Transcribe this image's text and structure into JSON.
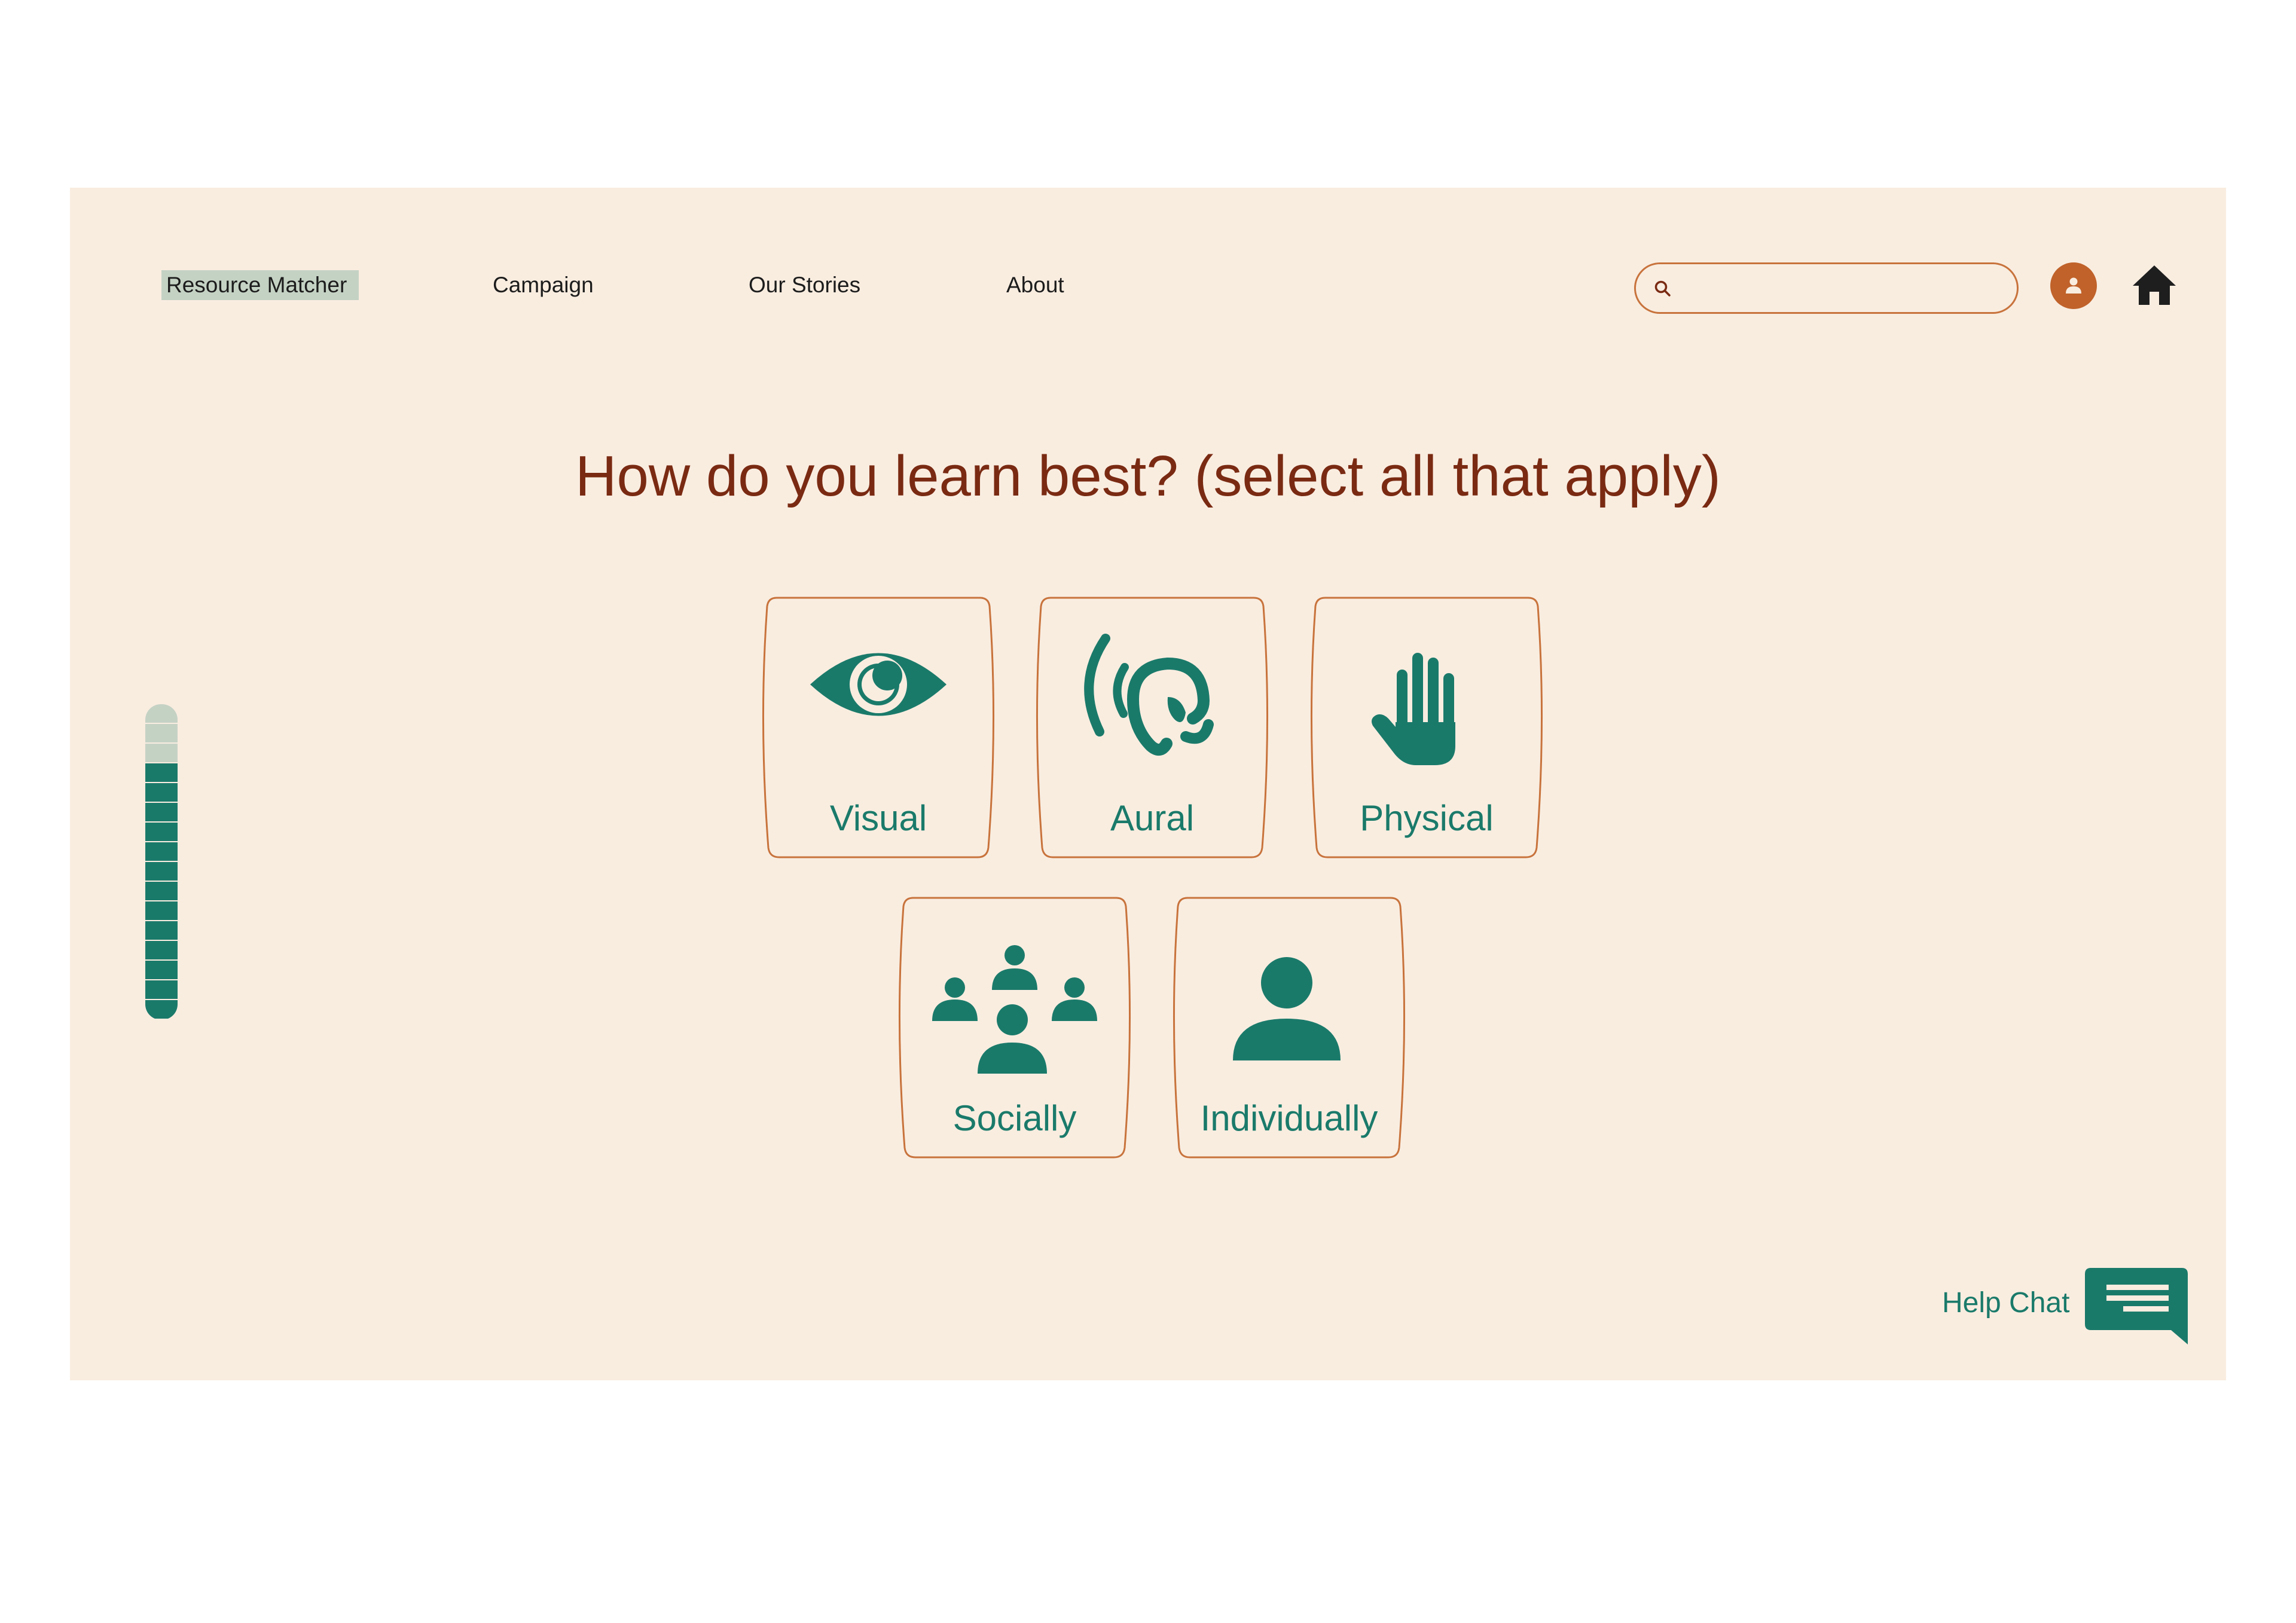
{
  "nav": {
    "items": [
      {
        "label": "Resource Matcher",
        "active": true
      },
      {
        "label": "Campaign"
      },
      {
        "label": "Our Stories"
      },
      {
        "label": "About"
      }
    ]
  },
  "search": {
    "value": "",
    "placeholder": ""
  },
  "icons": {
    "search": "search-icon",
    "avatar": "user-icon",
    "home": "home-icon",
    "chat": "chat-bubble-icon"
  },
  "question": {
    "title": "How do you learn best? (select all that apply)"
  },
  "options": [
    {
      "label": "Visual",
      "icon": "eye-icon"
    },
    {
      "label": "Aural",
      "icon": "ear-icon"
    },
    {
      "label": "Physical",
      "icon": "hand-icon"
    },
    {
      "label": "Socially",
      "icon": "group-icon"
    },
    {
      "label": "Individually",
      "icon": "person-icon"
    }
  ],
  "progress": {
    "segments_total": 16,
    "segments_filled": 13,
    "fraction": 0.8125
  },
  "help_chat": {
    "label": "Help Chat"
  },
  "colors": {
    "background": "#f9ede0",
    "accent": "#1a7a6a",
    "heading": "#7a2a12",
    "border": "#c8733c",
    "avatar": "#c0622a",
    "progress_empty": "#c4d2c4",
    "nav_active": "#c4d2c4"
  }
}
